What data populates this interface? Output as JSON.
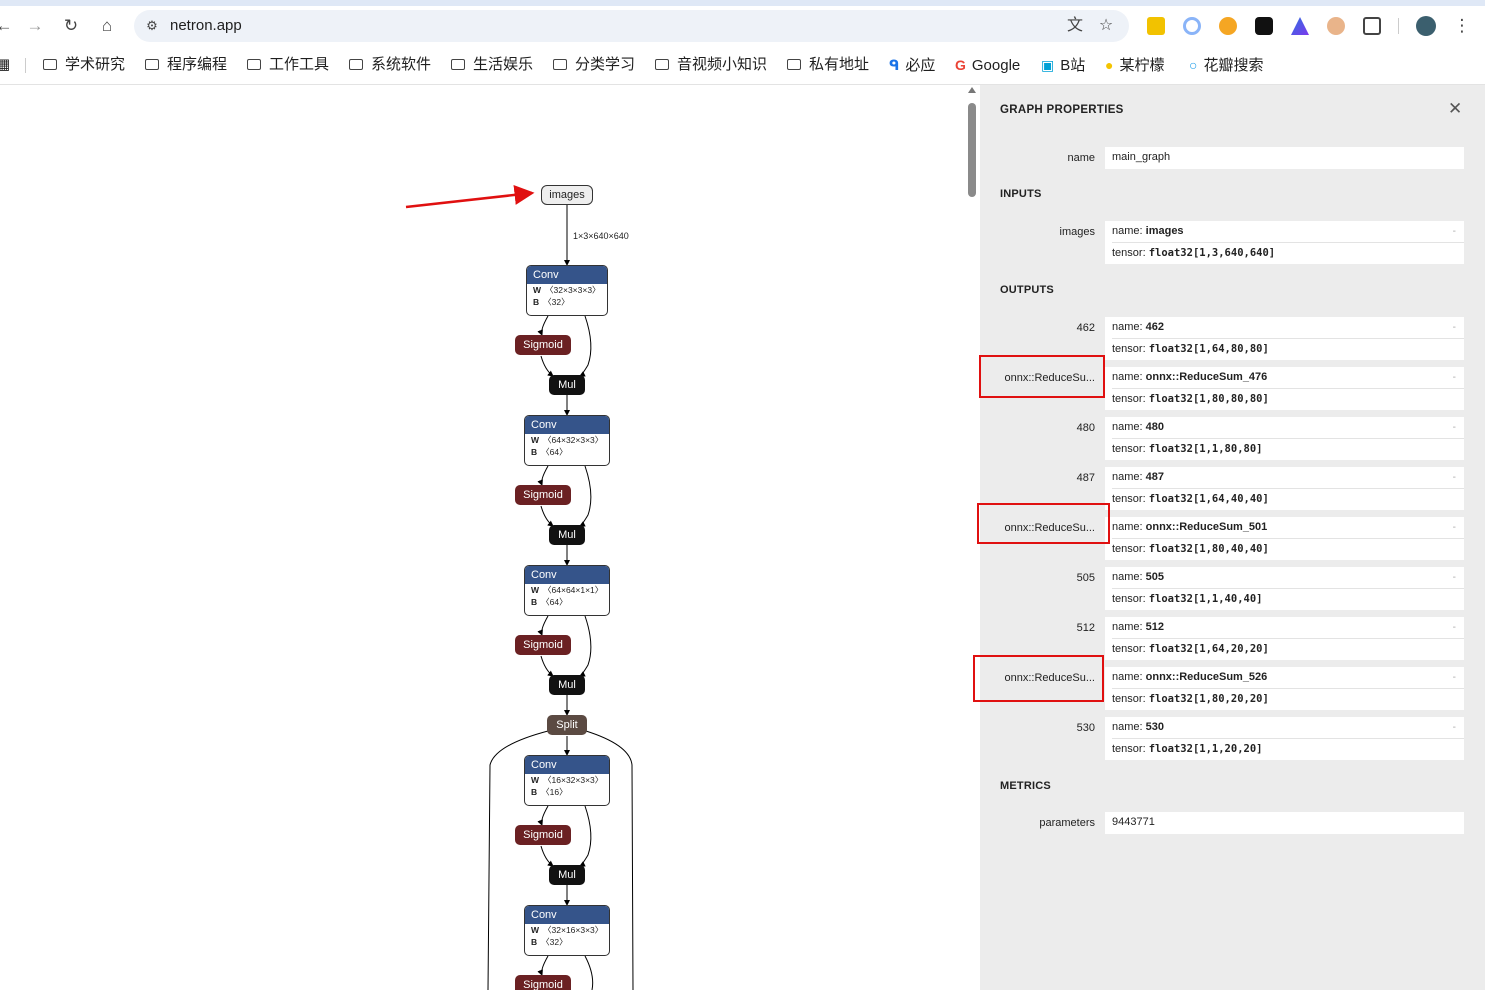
{
  "browser": {
    "url": "netron.app",
    "bookmarks": [
      {
        "label": "学术研究"
      },
      {
        "label": "程序编程"
      },
      {
        "label": "工作工具"
      },
      {
        "label": "系统软件"
      },
      {
        "label": "生活娱乐"
      },
      {
        "label": "分类学习"
      },
      {
        "label": "音视频小知识"
      },
      {
        "label": "私有地址"
      },
      {
        "label": "必应"
      },
      {
        "label": "Google"
      },
      {
        "label": "B站"
      },
      {
        "label": "某柠檬"
      },
      {
        "label": "花瓣搜索"
      }
    ]
  },
  "graph": {
    "input_node": "images",
    "input_edge_label": "1×3×640×640",
    "conv_nodes": [
      {
        "title": "Conv",
        "w": "〈32×3×3×3〉",
        "b": "〈32〉"
      },
      {
        "title": "Conv",
        "w": "〈64×32×3×3〉",
        "b": "〈64〉"
      },
      {
        "title": "Conv",
        "w": "〈64×64×1×1〉",
        "b": "〈64〉"
      },
      {
        "title": "Conv",
        "w": "〈16×32×3×3〉",
        "b": "〈16〉"
      },
      {
        "title": "Conv",
        "w": "〈32×16×3×3〉",
        "b": "〈32〉"
      }
    ],
    "sigmoid_label": "Sigmoid",
    "mul_label": "Mul",
    "split_label": "Split",
    "w_label": "W",
    "b_label": "B"
  },
  "panel": {
    "title": "GRAPH PROPERTIES",
    "name_label": "name",
    "name_value": "main_graph",
    "inputs_header": "INPUTS",
    "inputs": [
      {
        "label": "images",
        "name": "images",
        "tensor": "float32[1,3,640,640]"
      }
    ],
    "outputs_header": "OUTPUTS",
    "outputs": [
      {
        "label": "462",
        "name": "462",
        "tensor": "float32[1,64,80,80]"
      },
      {
        "label": "onnx::ReduceSu...",
        "name": "onnx::ReduceSum_476",
        "tensor": "float32[1,80,80,80]"
      },
      {
        "label": "480",
        "name": "480",
        "tensor": "float32[1,1,80,80]"
      },
      {
        "label": "487",
        "name": "487",
        "tensor": "float32[1,64,40,40]"
      },
      {
        "label": "onnx::ReduceSu...",
        "name": "onnx::ReduceSum_501",
        "tensor": "float32[1,80,40,40]"
      },
      {
        "label": "505",
        "name": "505",
        "tensor": "float32[1,1,40,40]"
      },
      {
        "label": "512",
        "name": "512",
        "tensor": "float32[1,64,20,20]"
      },
      {
        "label": "onnx::ReduceSu...",
        "name": "onnx::ReduceSum_526",
        "tensor": "float32[1,80,20,20]"
      },
      {
        "label": "530",
        "name": "530",
        "tensor": "float32[1,1,20,20]"
      }
    ],
    "metrics_header": "METRICS",
    "parameters_label": "parameters",
    "parameters_value": "9443771",
    "field_name": "name: ",
    "field_tensor": "tensor: "
  }
}
